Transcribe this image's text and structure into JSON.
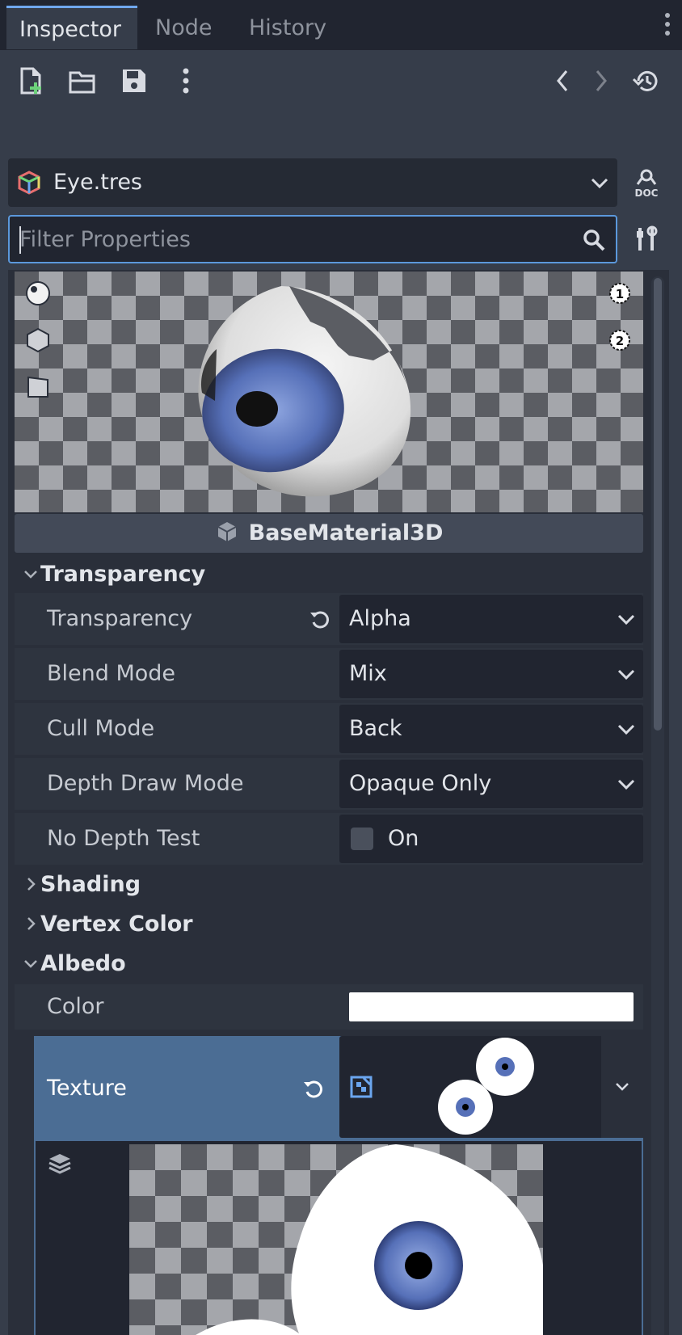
{
  "tabs": [
    {
      "label": "Inspector",
      "active": true
    },
    {
      "label": "Node",
      "active": false
    },
    {
      "label": "History",
      "active": false
    }
  ],
  "toolbar": {
    "icons": [
      "new-resource-icon",
      "open-folder-icon",
      "save-icon",
      "more-vertical-icon",
      "back-icon",
      "forward-icon",
      "history-icon"
    ]
  },
  "resource": {
    "name": "Eye.tres",
    "doc_label": "DOC"
  },
  "filter": {
    "placeholder": "Filter Properties"
  },
  "preview": {
    "light_buttons": [
      "1",
      "2"
    ]
  },
  "class_name": "BaseMaterial3D",
  "sections": {
    "transparency": "Transparency",
    "shading": "Shading",
    "vertex_color": "Vertex Color",
    "albedo": "Albedo"
  },
  "properties": {
    "transparency": {
      "label": "Transparency",
      "value": "Alpha"
    },
    "blend_mode": {
      "label": "Blend Mode",
      "value": "Mix"
    },
    "cull_mode": {
      "label": "Cull Mode",
      "value": "Back"
    },
    "depth_draw_mode": {
      "label": "Depth Draw Mode",
      "value": "Opaque Only"
    },
    "no_depth_test": {
      "label": "No Depth Test",
      "value": "On",
      "checked": false
    },
    "color": {
      "label": "Color",
      "value": "#ffffff"
    },
    "texture": {
      "label": "Texture"
    }
  },
  "colors": {
    "accent": "#5b98dc",
    "selection": "#4b6d94",
    "iris": "#5670b8"
  }
}
